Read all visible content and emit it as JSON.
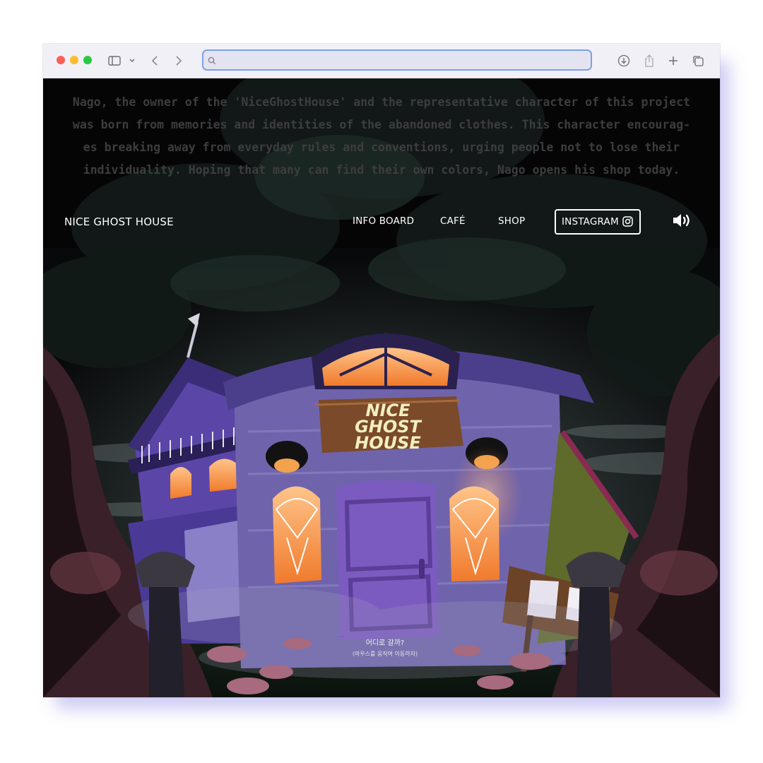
{
  "browser": {
    "url_value": "",
    "icons": [
      "sidebar-icon",
      "chevron-down-icon",
      "back-icon",
      "forward-icon",
      "search-icon",
      "download-icon",
      "share-icon",
      "new-tab-icon",
      "tabs-icon"
    ]
  },
  "intro": {
    "lines": [
      "Nago, the owner of the 'NiceGhostHouse' and the representative character of this project",
      "was born from memories and identities of the abandoned clothes. This character encourag-",
      "es breaking away from everyday rules and conventions, urging people not to lose their",
      "individuality. Hoping that many can find their own colors, Nago opens his shop today."
    ]
  },
  "nav": {
    "brand": "NICE GHOST HOUSE",
    "links": [
      "INFO BOARD",
      "CAFÉ",
      "SHOP"
    ],
    "instagram_label": "INSTAGRAM"
  },
  "sign": {
    "line1": "NICE",
    "line2": "GHOST",
    "line3": "HOUSE"
  },
  "hint": {
    "title": "어디로 갈까?",
    "subtitle": "(마우스를 움직여 이동하자)"
  },
  "colors": {
    "brand_purple": "#6a4fc4",
    "window_glow": "#ff9a45",
    "sign_text": "#f3eec0"
  }
}
